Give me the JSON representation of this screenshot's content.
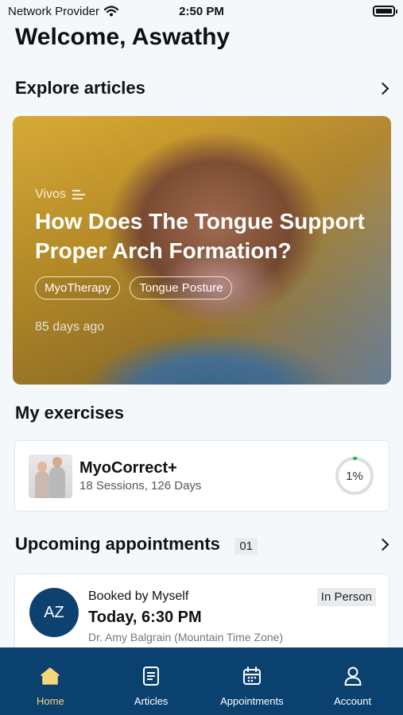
{
  "status_bar": {
    "carrier": "Network Provider",
    "time": "2:50 PM"
  },
  "welcome": "Welcome, Aswathy",
  "explore": {
    "title": "Explore articles",
    "article": {
      "source": "Vivos",
      "title": "How Does The Tongue Support Proper Arch Formation?",
      "tags": [
        "MyoTherapy",
        "Tongue Posture"
      ],
      "age": "85 days ago"
    }
  },
  "exercises": {
    "title": "My exercises",
    "item": {
      "name": "MyoCorrect+",
      "meta": "18 Sessions, 126 Days",
      "progress_label": "1%",
      "progress": 0.01
    }
  },
  "appointments": {
    "title": "Upcoming appointments",
    "count": "01",
    "item": {
      "avatar_initials": "AZ",
      "booked_by": "Booked by Myself",
      "time": "Today, 6:30 PM",
      "doctor": "Dr. Amy Balgrain (Mountain Time Zone)",
      "mode": "In Person"
    }
  },
  "nav": {
    "items": [
      {
        "label": "Home",
        "icon": "home-icon"
      },
      {
        "label": "Articles",
        "icon": "articles-icon"
      },
      {
        "label": "Appointments",
        "icon": "calendar-icon"
      },
      {
        "label": "Account",
        "icon": "account-icon"
      }
    ]
  },
  "colors": {
    "nav_background": "#0b416f",
    "nav_active": "#f6d67a",
    "avatar": "#0d4170"
  }
}
